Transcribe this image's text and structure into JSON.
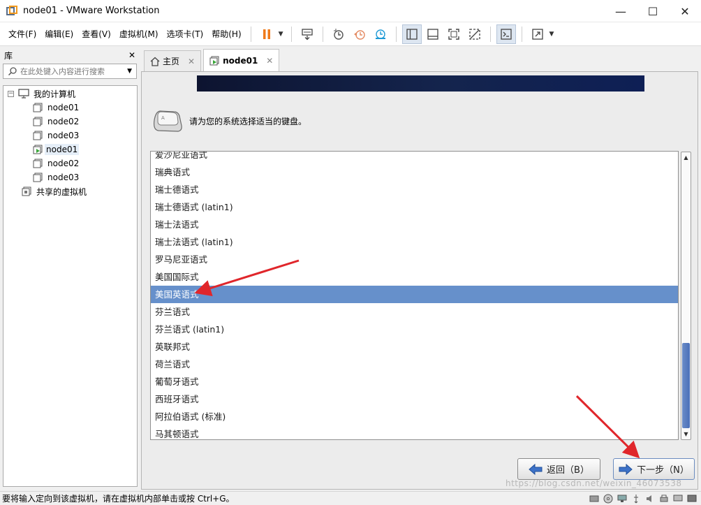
{
  "window": {
    "title": "node01 - VMware Workstation",
    "controls": [
      "—",
      "☐",
      "✕"
    ]
  },
  "menu": {
    "items": [
      "文件(F)",
      "编辑(E)",
      "查看(V)",
      "虚拟机(M)",
      "选项卡(T)",
      "帮助(H)"
    ]
  },
  "sidebar": {
    "header": "库",
    "close": "✕",
    "search_placeholder": "在此处键入内容进行搜索",
    "tree": {
      "root": "我的计算机",
      "expander": "⊟",
      "vms": [
        "node01",
        "node02",
        "node03",
        "node01",
        "node02",
        "node03"
      ],
      "selected_index": 3,
      "running_index": 3,
      "shared": "共享的虚拟机"
    }
  },
  "tabs": [
    {
      "label": "主页",
      "icon": "home-icon",
      "close": "✕"
    },
    {
      "label": "node01",
      "icon": "vm-running-icon",
      "close": "✕",
      "active": true
    }
  ],
  "installer": {
    "prompt": "请为您的系统选择适当的键盘。",
    "keyboards": [
      "爱沙尼亚语式",
      "瑞典语式",
      "瑞士德语式",
      "瑞士德语式 (latin1)",
      "瑞士法语式",
      "瑞士法语式 (latin1)",
      "罗马尼亚语式",
      "美国国际式",
      "美国英语式",
      "芬兰语式",
      "芬兰语式 (latin1)",
      "英联邦式",
      "荷兰语式",
      "葡萄牙语式",
      "西班牙语式",
      "阿拉伯语式 (标准)",
      "马其顿语式"
    ],
    "selected": "美国英语式",
    "scroll_arrows": {
      "up": "▲",
      "down": "▼"
    },
    "back_button": "返回（B）",
    "next_button": "下一步（N）"
  },
  "status": {
    "message": "要将输入定向到该虚拟机，请在虚拟机内部单击或按 Ctrl+G。",
    "watermark": "https://blog.csdn.net/weixin_46073538"
  },
  "colors": {
    "selection": "#6690cb",
    "annotation_arrow": "#e0262b",
    "banner": "#0e1a3e"
  }
}
